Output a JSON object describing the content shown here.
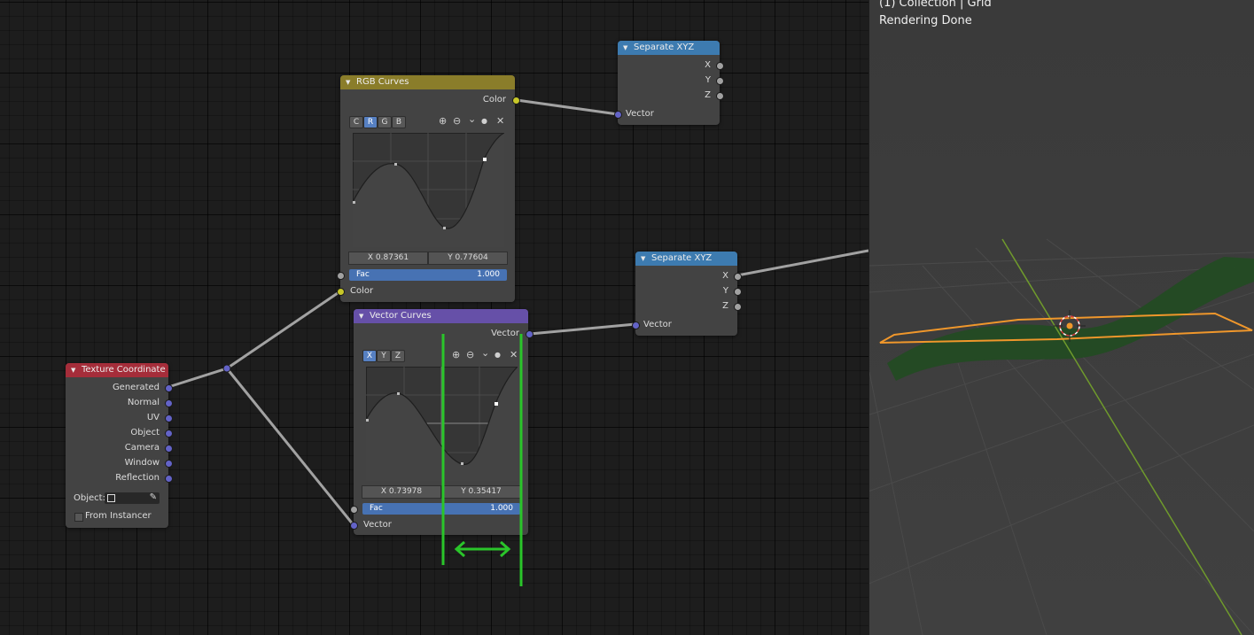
{
  "colors": {
    "link": "#a2a2a2",
    "vector_socket": "#6363c7",
    "color_socket": "#c7c729",
    "gray_socket": "#a1a1a1",
    "rgb_curves_header": "#8a7d2a",
    "vector_curves_header": "#6650a8",
    "separate_xyz_header": "#3d7bb0",
    "texture_coord_header": "#a52d3a",
    "selection_orange": "#f0972b",
    "annotation_green": "#2ac52a"
  },
  "nodes": {
    "texture_coordinate": {
      "title": "Texture Coordinate",
      "outputs": [
        "Generated",
        "Normal",
        "UV",
        "Object",
        "Camera",
        "Window",
        "Reflection"
      ],
      "object_label": "Object:",
      "from_instancer_label": "From Instancer"
    },
    "rgb_curves": {
      "title": "RGB Curves",
      "output_label": "Color",
      "channel_buttons": [
        "C",
        "R",
        "G",
        "B"
      ],
      "active_channel": "R",
      "coord_x": "X 0.87361",
      "coord_y": "Y 0.77604",
      "fac_label": "Fac",
      "fac_value": "1.000",
      "input_label": "Color"
    },
    "vector_curves": {
      "title": "Vector Curves",
      "output_label": "Vector",
      "channel_buttons": [
        "X",
        "Y",
        "Z"
      ],
      "active_channel": "X",
      "coord_x": "X 0.73978",
      "coord_y": "Y 0.35417",
      "fac_label": "Fac",
      "fac_value": "1.000",
      "input_label": "Vector"
    },
    "separate_xyz_top": {
      "title": "Separate XYZ",
      "outputs": [
        "X",
        "Y",
        "Z"
      ],
      "input_label": "Vector"
    },
    "separate_xyz_mid": {
      "title": "Separate XYZ",
      "outputs": [
        "X",
        "Y",
        "Z"
      ],
      "input_label": "Vector"
    }
  },
  "icons": {
    "collapse": "▼",
    "zoom_in": "⊕",
    "zoom_out": "⊖",
    "dropdown": "⌄",
    "dot": "●",
    "close": "✕",
    "eyedropper": "eyedropper-icon"
  },
  "viewport": {
    "line1": "(1) Collection | Grid",
    "line2": "Rendering Done"
  }
}
